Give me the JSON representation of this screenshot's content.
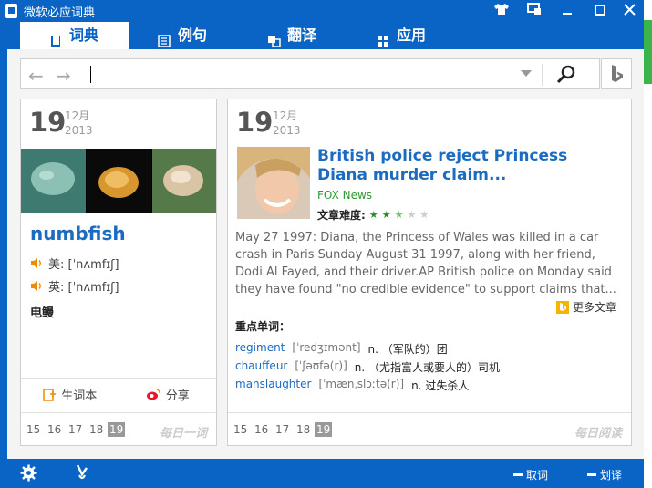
{
  "app": {
    "title": "微软必应词典"
  },
  "tabs": [
    {
      "label": "词典",
      "icon": "book-icon",
      "active": true
    },
    {
      "label": "例句",
      "icon": "sentence-icon",
      "active": false
    },
    {
      "label": "翻译",
      "icon": "translate-icon",
      "active": false
    },
    {
      "label": "应用",
      "icon": "apps-icon",
      "active": false
    }
  ],
  "search": {
    "value": "",
    "placeholder": ""
  },
  "word_card": {
    "day": "19",
    "month": "12月",
    "year": "2013",
    "word": "numbfish",
    "us_label": "美: [ˈnʌmfɪʃ]",
    "uk_label": "英: [ˈnʌmfɪʃ]",
    "meaning": "电鳗",
    "wordbook_label": "生词本",
    "share_label": "分享",
    "dates": [
      "15",
      "16",
      "17",
      "18",
      "19"
    ],
    "selected_date": "19",
    "daily_label": "每日一词"
  },
  "article_card": {
    "day": "19",
    "month": "12月",
    "year": "2013",
    "headline": "British police reject Princess Diana murder claim...",
    "source": "FOX News",
    "difficulty_label": "文章难度:",
    "difficulty": 2.5,
    "difficulty_max": 5,
    "body": "May 27 1997: Diana, the Princess of Wales was killed in a car crash in Paris Sunday August 31 1997, along with her friend, Dodi Al Fayed, and their driver.AP British police on Monday said they have found \"no credible evidence\" to support claims that...",
    "more_label": "更多文章",
    "key_heading": "重点单词：",
    "key_words": [
      {
        "word": "regiment",
        "phon": "[ˈredʒɪmənt]",
        "def": "n. （军队的）团"
      },
      {
        "word": "chauffeur",
        "phon": "[ˈʃəʊfə(r)]",
        "def": "n. （尤指富人或要人的）司机"
      },
      {
        "word": "manslaughter",
        "phon": "[ˈmænˌslɔːtə(r)]",
        "def": "n. 过失杀人"
      }
    ],
    "dates": [
      "15",
      "16",
      "17",
      "18",
      "19"
    ],
    "selected_date": "19",
    "daily_label": "每日阅读"
  },
  "bottom": {
    "pick_label": "取词",
    "select_label": "划译"
  },
  "colors": {
    "brand": "#0a64c6",
    "link": "#1b6cc1",
    "source": "#2e9a2e"
  }
}
